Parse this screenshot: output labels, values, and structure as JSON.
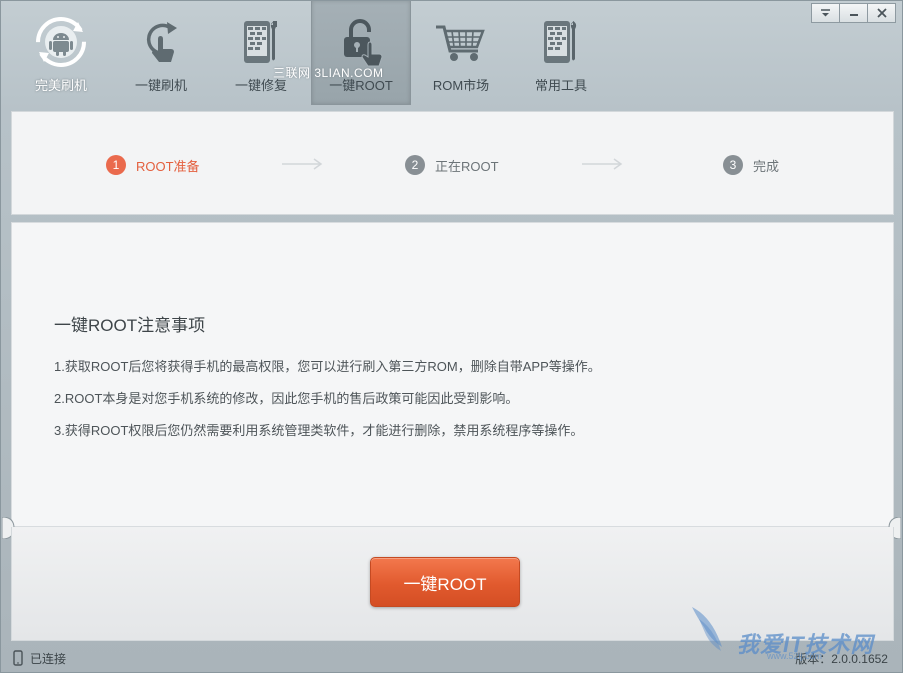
{
  "window": {
    "controls": [
      "menu",
      "minimize",
      "close"
    ]
  },
  "toolbar": {
    "items": [
      {
        "label": "完美刷机",
        "icon": "android-refresh-icon"
      },
      {
        "label": "一键刷机",
        "icon": "touch-refresh-icon"
      },
      {
        "label": "一键修复",
        "icon": "phone-wrench-icon"
      },
      {
        "label": "一键ROOT",
        "icon": "unlock-touch-icon"
      },
      {
        "label": "ROM市场",
        "icon": "shopping-cart-icon"
      },
      {
        "label": "常用工具",
        "icon": "phone-tools-icon"
      }
    ],
    "active_index": 3,
    "overlay_watermark": "三联网 3LIAN.COM"
  },
  "steps": {
    "items": [
      {
        "num": "1",
        "label": "ROOT准备"
      },
      {
        "num": "2",
        "label": "正在ROOT"
      },
      {
        "num": "3",
        "label": "完成"
      }
    ],
    "current": 1
  },
  "notice": {
    "title": "一键ROOT注意事项",
    "lines": [
      "1.获取ROOT后您将获得手机的最高权限，您可以进行刷入第三方ROM，删除自带APP等操作。",
      "2.ROOT本身是对您手机系统的修改，因此您手机的售后政策可能因此受到影响。",
      "3.获得ROOT权限后您仍然需要利用系统管理类软件，才能进行删除，禁用系统程序等操作。"
    ]
  },
  "action": {
    "root_button": "一键ROOT"
  },
  "status": {
    "connection": "已连接",
    "version": "版本：2.0.0.1652"
  },
  "watermark": {
    "text": "我爱IT技术网",
    "url": "www.52ij.com"
  },
  "colors": {
    "accent": "#e15a2e",
    "step_current": "#ea6a4d",
    "step_inactive": "#888f94"
  }
}
